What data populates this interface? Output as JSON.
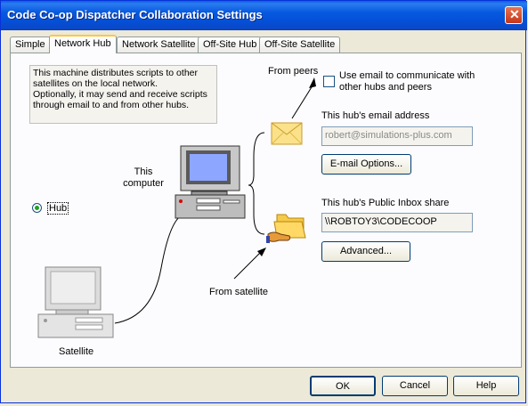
{
  "window": {
    "title": "Code Co-op Dispatcher Collaboration Settings"
  },
  "tabs": [
    {
      "label": "Simple"
    },
    {
      "label": "Network Hub",
      "active": true
    },
    {
      "label": "Network Satellite"
    },
    {
      "label": "Off-Site Hub"
    },
    {
      "label": "Off-Site Satellite"
    }
  ],
  "panel": {
    "description": "This machine distributes scripts to other satellites on the local network.\nOptionally, it may send and receive scripts through email to and from other hubs.",
    "from_peers": "From peers",
    "use_email_label": "Use email to communicate with other hubs and peers",
    "use_email_checked": false,
    "email_address_label": "This hub's email address",
    "email_address_value": "robert@simulations-plus.com",
    "email_options_button": "E-mail Options...",
    "this_computer": "This computer",
    "hub_label": "Hub",
    "public_inbox_label": "This hub's Public Inbox share",
    "public_inbox_value": "\\\\ROBTOY3\\CODECOOP",
    "advanced_button": "Advanced...",
    "from_satellite": "From satellite",
    "satellite_label": "Satellite"
  },
  "footer": {
    "ok": "OK",
    "cancel": "Cancel",
    "help": "Help"
  },
  "icons": [
    "close-icon",
    "envelope-icon",
    "folder-hand-icon",
    "computer-icon",
    "satellite-computer-icon",
    "arrow-icon"
  ]
}
